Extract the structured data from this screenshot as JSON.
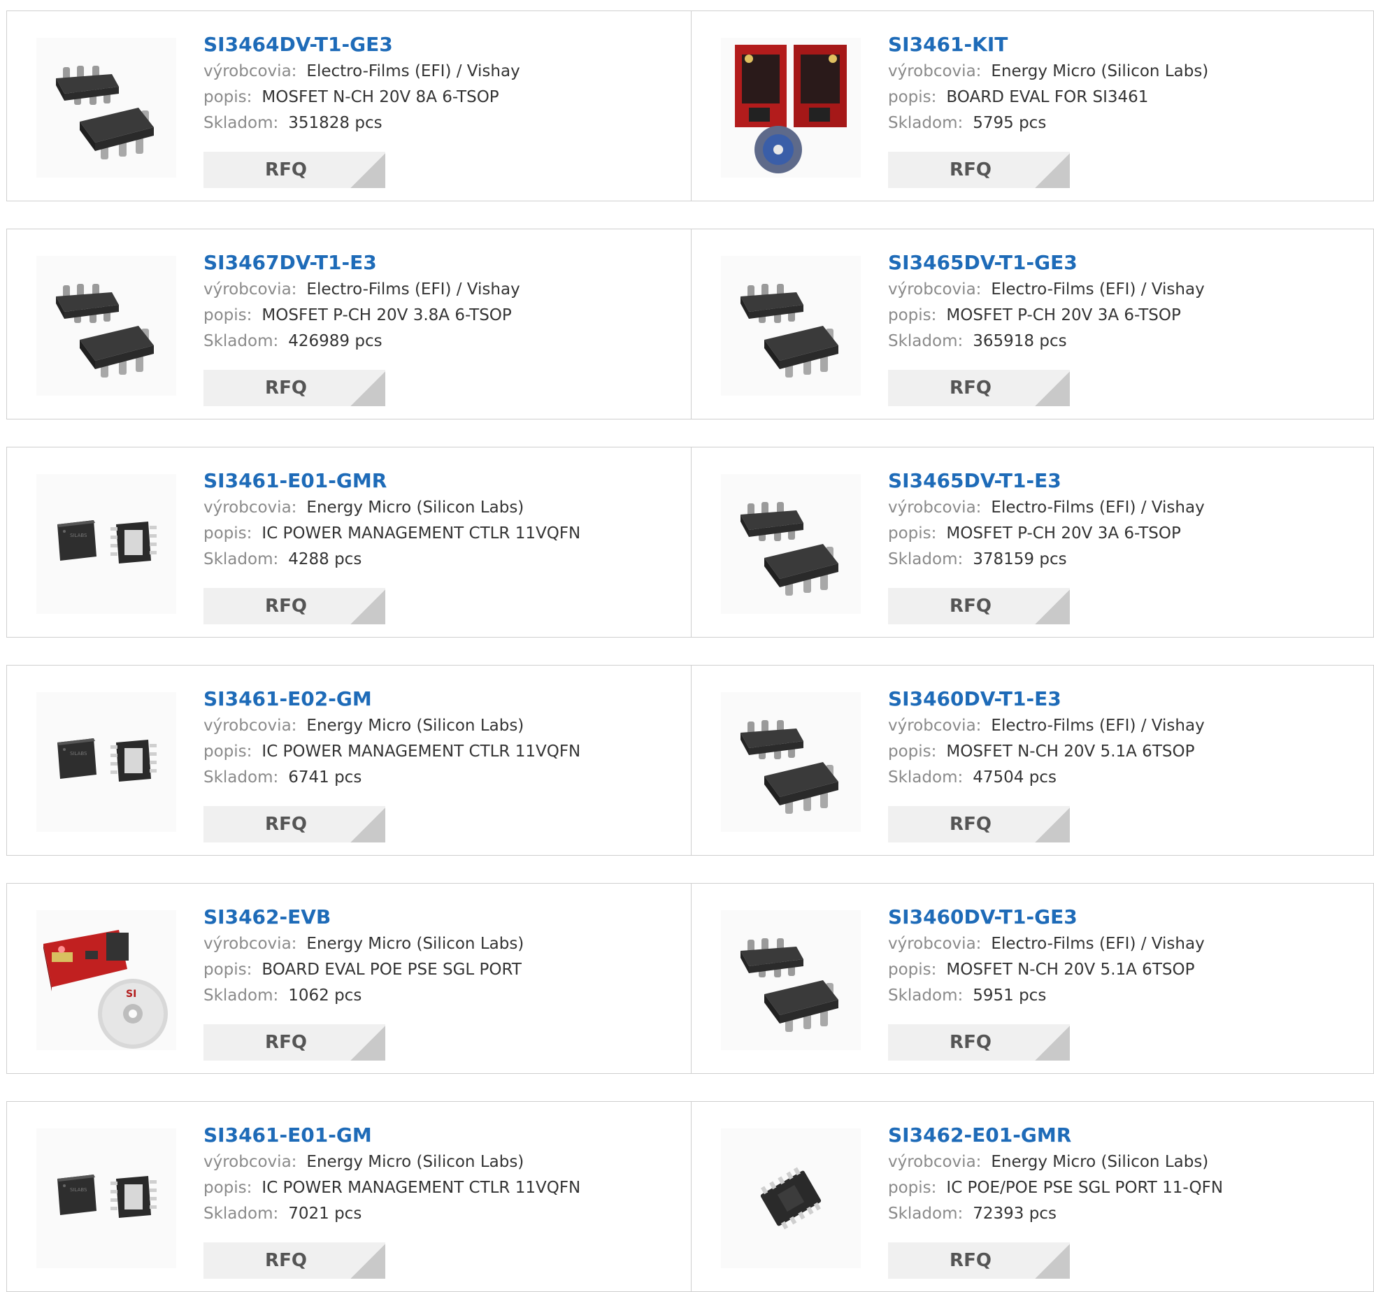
{
  "labels": {
    "manufacturer": "výrobcovia:",
    "description": "popis:",
    "stock": "Skladom:",
    "rfq": "RFQ"
  },
  "colors": {
    "link": "#1e6bb8",
    "label": "#8a8a8a",
    "value": "#333333",
    "button_bg": "#f0f0f0",
    "button_corner": "#c9c9c9",
    "border": "#cfcfcf"
  },
  "products": [
    {
      "part": "SI3464DV-T1-GE3",
      "manufacturer": "Electro-Films (EFI) / Vishay",
      "description": "MOSFET N-CH 20V 8A 6-TSOP",
      "stock": "351828 pcs",
      "image": "tsop6-chip-icon"
    },
    {
      "part": "SI3461-KIT",
      "manufacturer": "Energy Micro (Silicon Labs)",
      "description": "BOARD EVAL FOR SI3461",
      "stock": "5795 pcs",
      "image": "eval-kit-icon"
    },
    {
      "part": "SI3467DV-T1-E3",
      "manufacturer": "Electro-Films (EFI) / Vishay",
      "description": "MOSFET P-CH 20V 3.8A 6-TSOP",
      "stock": "426989 pcs",
      "image": "tsop6-chip-icon"
    },
    {
      "part": "SI3465DV-T1-GE3",
      "manufacturer": "Electro-Films (EFI) / Vishay",
      "description": "MOSFET P-CH 20V 3A 6-TSOP",
      "stock": "365918 pcs",
      "image": "tsop6-chip-icon"
    },
    {
      "part": "SI3461-E01-GMR",
      "manufacturer": "Energy Micro (Silicon Labs)",
      "description": "IC POWER MANAGEMENT CTLR 11VQFN",
      "stock": "4288 pcs",
      "image": "vqfn-chip-icon"
    },
    {
      "part": "SI3465DV-T1-E3",
      "manufacturer": "Electro-Films (EFI) / Vishay",
      "description": "MOSFET P-CH 20V 3A 6-TSOP",
      "stock": "378159 pcs",
      "image": "tsop6-chip-icon"
    },
    {
      "part": "SI3461-E02-GM",
      "manufacturer": "Energy Micro (Silicon Labs)",
      "description": "IC POWER MANAGEMENT CTLR 11VQFN",
      "stock": "6741 pcs",
      "image": "vqfn-chip-icon"
    },
    {
      "part": "SI3460DV-T1-E3",
      "manufacturer": "Electro-Films (EFI) / Vishay",
      "description": "MOSFET N-CH 20V 5.1A 6TSOP",
      "stock": "47504 pcs",
      "image": "tsop6-chip-icon"
    },
    {
      "part": "SI3462-EVB",
      "manufacturer": "Energy Micro (Silicon Labs)",
      "description": "BOARD EVAL POE PSE SGL PORT",
      "stock": "1062 pcs",
      "image": "eval-board-cd-icon"
    },
    {
      "part": "SI3460DV-T1-GE3",
      "manufacturer": "Electro-Films (EFI) / Vishay",
      "description": "MOSFET N-CH 20V 5.1A 6TSOP",
      "stock": "5951 pcs",
      "image": "tsop6-chip-icon"
    },
    {
      "part": "SI3461-E01-GM",
      "manufacturer": "Energy Micro (Silicon Labs)",
      "description": "IC POWER MANAGEMENT CTLR 11VQFN",
      "stock": "7021 pcs",
      "image": "vqfn-chip-icon"
    },
    {
      "part": "SI3462-E01-GMR",
      "manufacturer": "Energy Micro (Silicon Labs)",
      "description": "IC POE/POE PSE SGL PORT 11-QFN",
      "stock": "72393 pcs",
      "image": "qfn-chip-icon"
    }
  ]
}
